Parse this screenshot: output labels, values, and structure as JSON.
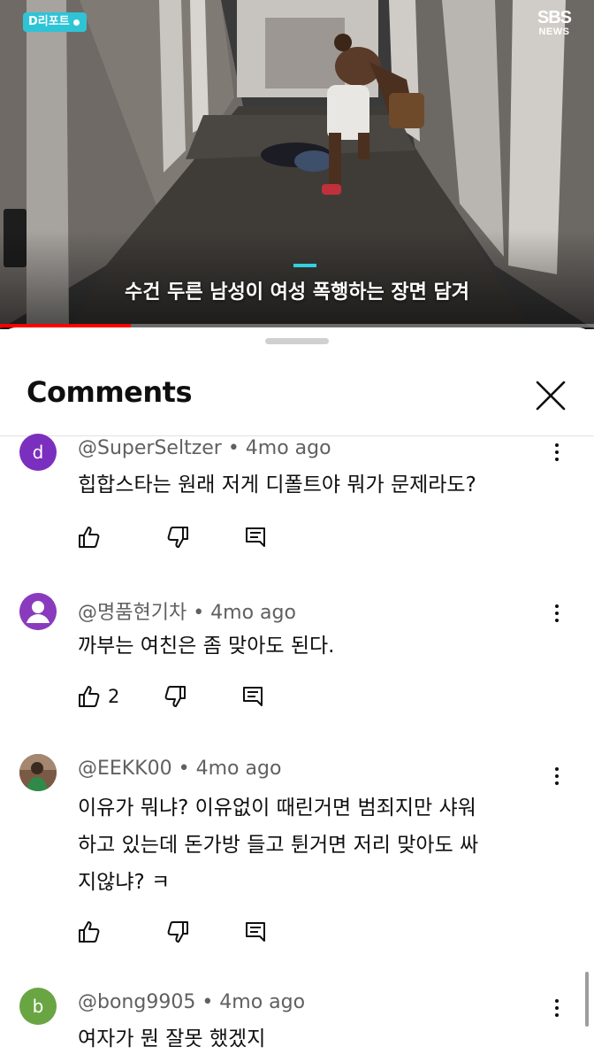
{
  "video": {
    "badge_label": "D리포트",
    "logo_top": "SBS",
    "logo_bottom": "NEWS",
    "caption": "수건 두른 남성이 여성 폭행하는 장면 담겨",
    "progress_fraction": 0.22
  },
  "sheet": {
    "title": "Comments",
    "close_icon": "close-icon"
  },
  "comments": [
    {
      "avatar_letter": "d",
      "avatar_color": "#7b2fbe",
      "author": "@SuperSeltzer",
      "age": "4mo ago",
      "lines": [
        "힙합스타는 원래 저게 디폴트야 뭐가 문제라도?"
      ],
      "likes": ""
    },
    {
      "avatar_letter": "",
      "avatar_color": "#8a3bbd",
      "author": "@명품현기차",
      "age": "4mo ago",
      "lines": [
        "까부는 여친은 좀 맞아도 된다."
      ],
      "likes": "2"
    },
    {
      "avatar_letter": "",
      "avatar_color": "#5a4636",
      "author": "@EEKK00",
      "age": "4mo ago",
      "lines": [
        "이유가 뭐냐? 이유없이 때린거면 범죄지만 샤워",
        "하고 있는데 돈가방 들고 튄거면 저리 맞아도 싸",
        "지않냐? ㅋ"
      ],
      "likes": ""
    },
    {
      "avatar_letter": "b",
      "avatar_color": "#6aa543",
      "author": "@bong9905",
      "age": "4mo ago",
      "lines": [
        "여자가 뭔 잘못 했겠지"
      ],
      "likes": ""
    }
  ],
  "separator": " • "
}
